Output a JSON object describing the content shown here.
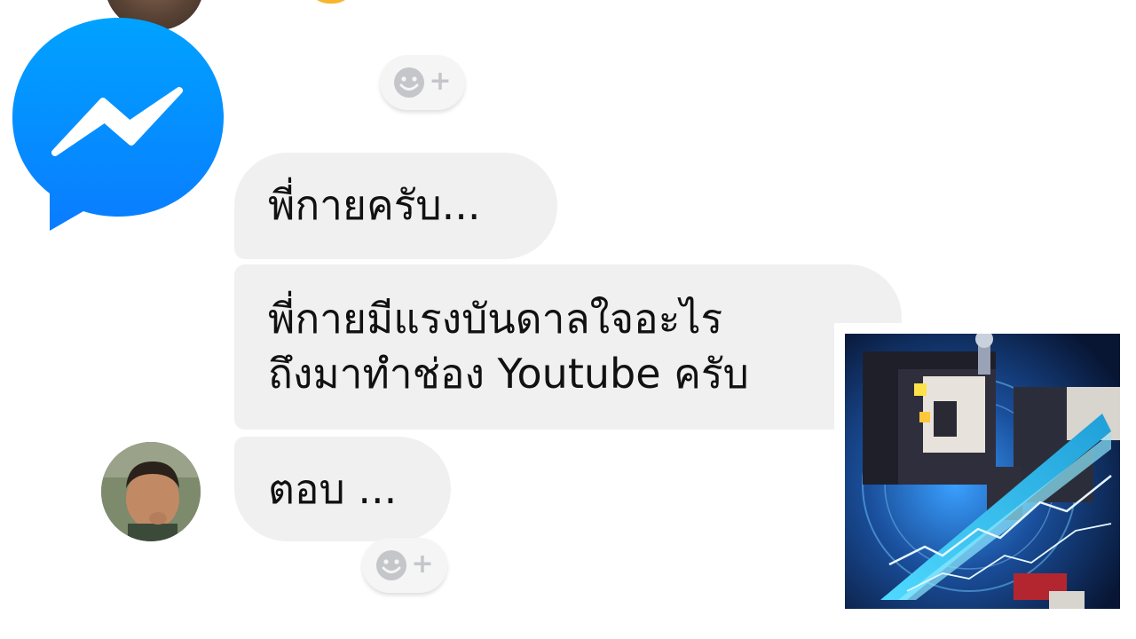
{
  "colors": {
    "bubble_background": "#f1f0f0",
    "messenger_blue": "#0a84ff",
    "page_background": "#ffffff",
    "reaction_icon": "#c4c6ca"
  },
  "icons": {
    "app_logo": "messenger-icon",
    "reaction": "add-reaction-icon"
  },
  "reactions": {
    "plus_symbol": "+"
  },
  "messages": [
    {
      "lines": [
        "พี่กายครับ..."
      ]
    },
    {
      "lines": [
        "พี่กายมีแรงบันดาลใจอะไร",
        "ถึงมาทำช่อง Youtube ครับ"
      ]
    },
    {
      "lines": [
        "ตอบ ..."
      ]
    }
  ]
}
